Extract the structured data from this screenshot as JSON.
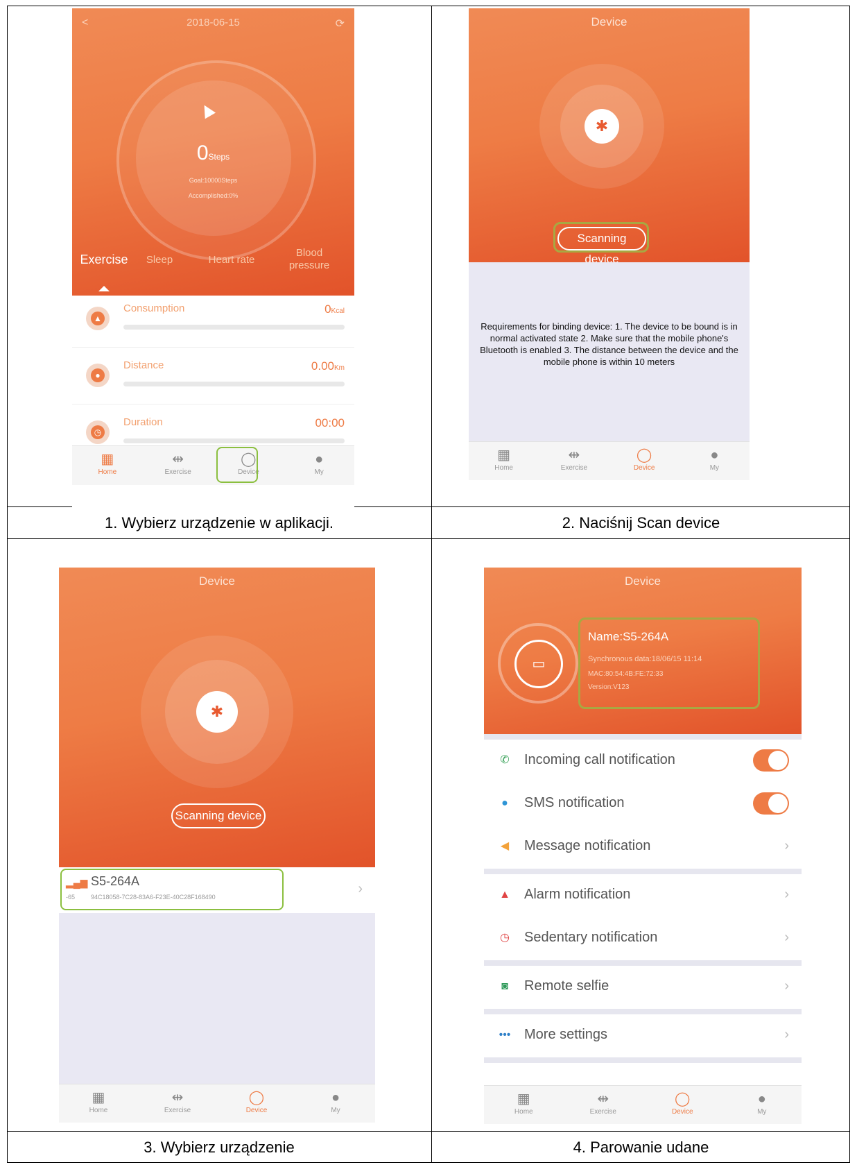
{
  "captions": [
    "1. Wybierz urządzenie w aplikacji.",
    "2. Naciśnij Scan device",
    "3. Wybierz urządzenie",
    "4. Parowanie udane"
  ],
  "nav": {
    "home": "Home",
    "exercise": "Exercise",
    "device": "Device",
    "my": "My"
  },
  "home_screen": {
    "date": "2018-06-15",
    "steps_value": "0",
    "steps_unit": "Steps",
    "goal": "Goal:10000Steps",
    "accomplished": "Accomplished:0%",
    "tabs": [
      "Exercise",
      "Sleep",
      "Heart rate",
      "Blood pressure"
    ],
    "metrics": [
      {
        "label": "Consumption",
        "value": "0",
        "unit": "Kcal",
        "icon": "flame-icon"
      },
      {
        "label": "Distance",
        "value": "0.00",
        "unit": "Km",
        "icon": "location-pin-icon"
      },
      {
        "label": "Duration",
        "value": "00:00",
        "unit": "",
        "icon": "clock-icon"
      }
    ]
  },
  "scan_screen": {
    "title": "Device",
    "scan_button": "Scanning device",
    "requirements": "Requirements for binding device: 1. The device to be bound is in normal activated state  2. Make sure that the mobile phone's Bluetooth is enabled  3. The distance between the device and the mobile phone is within 10 meters"
  },
  "select_screen": {
    "title": "Device",
    "scan_button": "Scanning device",
    "device_name": "S5-264A",
    "device_rssi": "-65",
    "device_uuid": "94C18058-7C28-83A6-F23E-40C28F168490"
  },
  "paired_screen": {
    "title": "Device",
    "name": "Name:S5-264A",
    "sync": "Synchronous data:18/06/15 11:14",
    "mac": "MAC:80:54:4B:FE:72:33",
    "version": "Version:V123",
    "settings": [
      {
        "label": "Incoming call notification",
        "icon": "phone-icon",
        "icon_color": "#3aa35a",
        "control": "toggle"
      },
      {
        "label": "SMS notification",
        "icon": "chat-bubble-icon",
        "icon_color": "#2f95d6",
        "control": "toggle"
      },
      {
        "label": "Message notification",
        "icon": "speaker-icon",
        "icon_color": "#f3a23a",
        "control": "chevron"
      },
      {
        "label": "Alarm notification",
        "icon": "bell-icon",
        "icon_color": "#e04444",
        "control": "chevron"
      },
      {
        "label": "Sedentary notification",
        "icon": "clock-icon",
        "icon_color": "#e04444",
        "control": "chevron"
      },
      {
        "label": "Remote selfie",
        "icon": "camera-icon",
        "icon_color": "#2f9a5a",
        "control": "chevron"
      },
      {
        "label": "More settings",
        "icon": "ellipsis-icon",
        "icon_color": "#2f80c8",
        "control": "chevron"
      }
    ]
  },
  "colors": {
    "accent": "#ee7b45",
    "header_dark": "#e2532a",
    "highlight_green": "#8bbf3f",
    "highlight_olive": "#a8a842",
    "panel_gray": "#e9e8f3"
  }
}
